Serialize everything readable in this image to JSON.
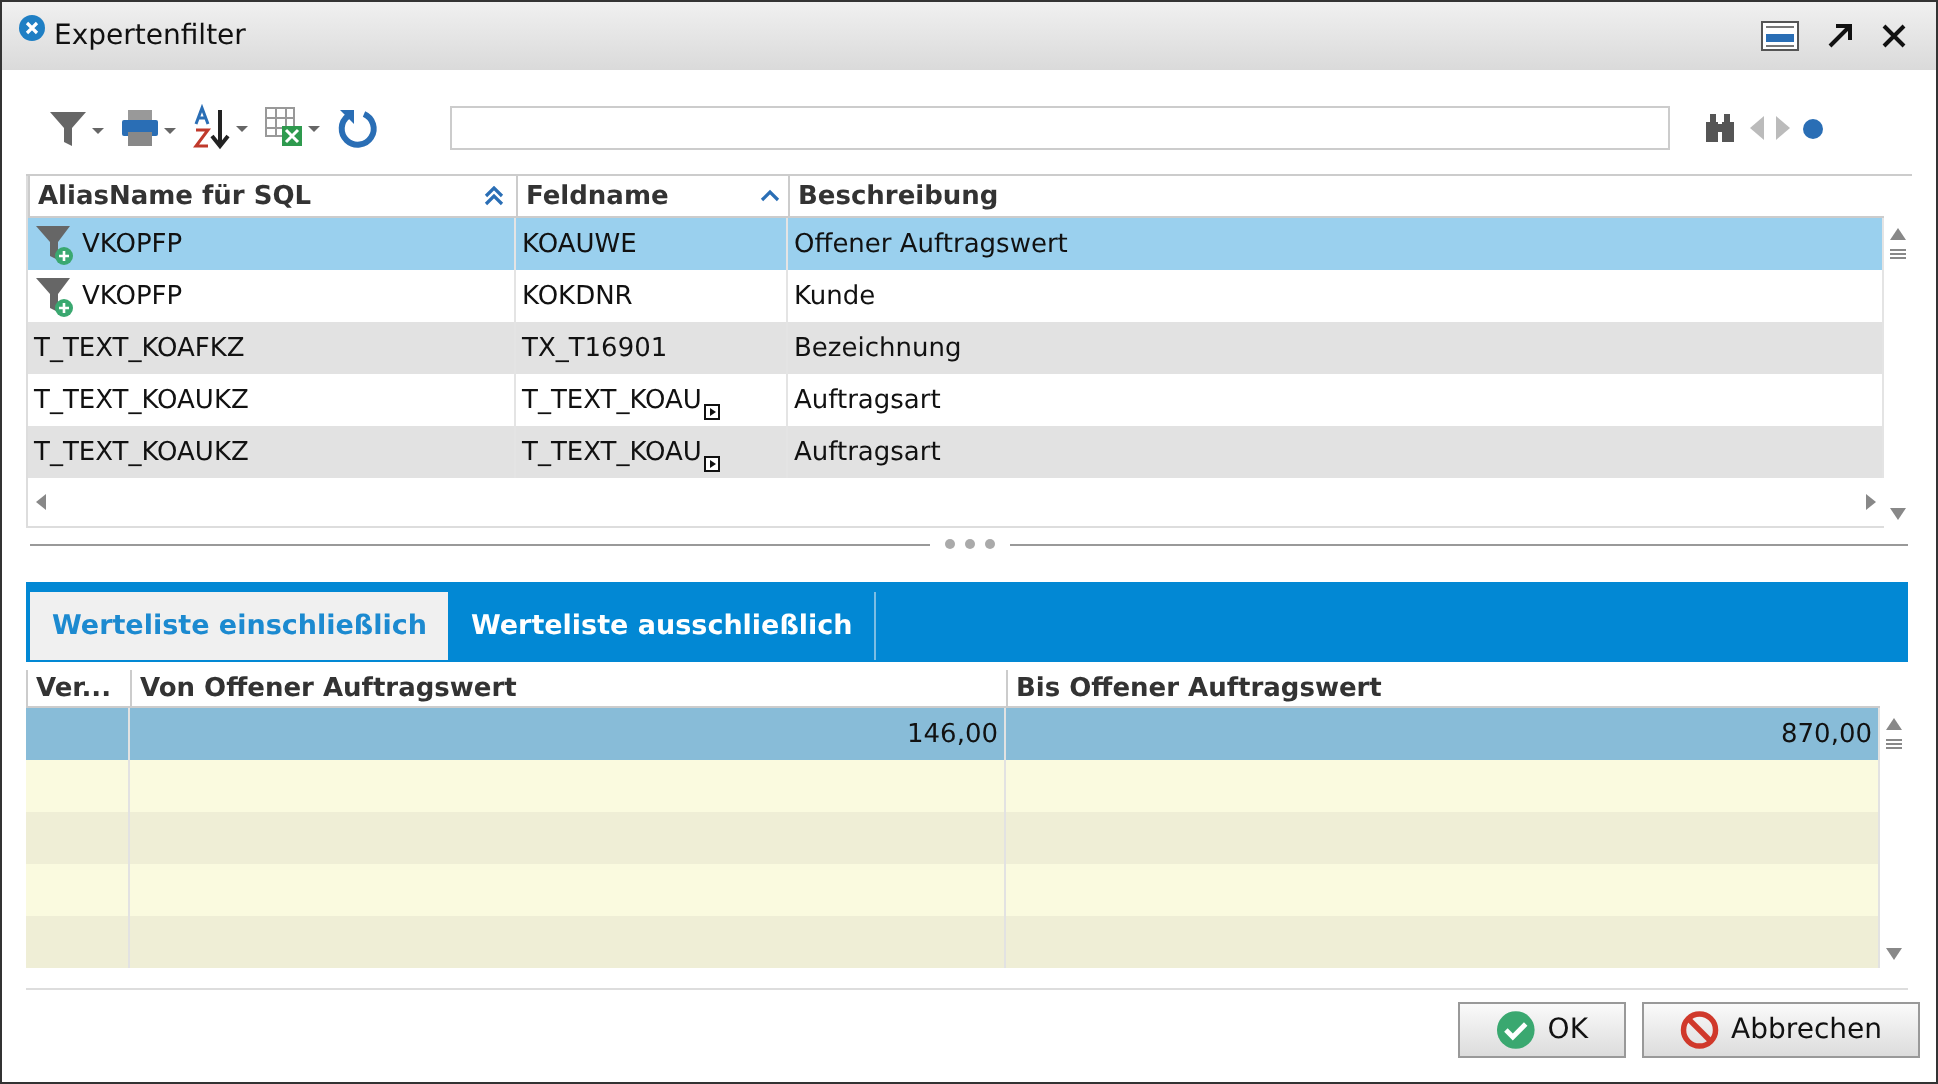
{
  "window": {
    "title": "Expertenfilter"
  },
  "fields_table": {
    "columns": [
      {
        "label": "AliasName für SQL",
        "kind": "double"
      },
      {
        "label": "Feldname",
        "kind": "single"
      },
      {
        "label": "Beschreibung",
        "kind": "plain"
      }
    ],
    "rows": [
      {
        "kind": "filter",
        "selected": true,
        "cells": [
          "VKOPFP",
          "KOAUWE",
          "Offener Auftragswert"
        ],
        "lookup": false
      },
      {
        "kind": "filter",
        "selected": false,
        "cells": [
          "VKOPFP",
          "KOKDNR",
          "Kunde"
        ],
        "lookup": false
      },
      {
        "kind": "plain",
        "selected": false,
        "cells": [
          "T_TEXT_KOAFKZ",
          "TX_T16901",
          "Bezeichnung"
        ],
        "lookup": false
      },
      {
        "kind": "plain",
        "selected": false,
        "cells": [
          "T_TEXT_KOAUKZ",
          "T_TEXT_KOAU",
          "Auftragsart"
        ],
        "lookup": true
      },
      {
        "kind": "plain",
        "selected": false,
        "cells": [
          "T_TEXT_KOAUKZ",
          "T_TEXT_KOAU",
          "Auftragsart"
        ],
        "lookup": true
      }
    ]
  },
  "tabs": [
    {
      "label": "Werteliste einschließlich",
      "selected": true
    },
    {
      "label": "Werteliste ausschließlich",
      "selected": false
    }
  ],
  "values_table": {
    "columns": [
      "Ver...",
      "Von Offener Auftragswert",
      "Bis Offener Auftragswert"
    ],
    "rows": [
      {
        "selected": true,
        "cells": [
          "",
          "146,00",
          "870,00"
        ]
      },
      {
        "selected": false,
        "cells": [
          "",
          "",
          ""
        ]
      },
      {
        "selected": false,
        "cells": [
          "",
          "",
          ""
        ]
      },
      {
        "selected": false,
        "cells": [
          "",
          "",
          ""
        ]
      },
      {
        "selected": false,
        "cells": [
          "",
          "",
          ""
        ]
      }
    ]
  },
  "buttons": [
    {
      "label": "OK",
      "kind": "ok"
    },
    {
      "label": "Abbrechen",
      "kind": "cancel"
    }
  ]
}
